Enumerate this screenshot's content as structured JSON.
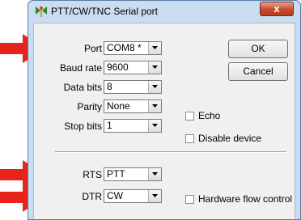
{
  "window": {
    "title": "PTT/CW/TNC Serial port",
    "close_label": "x",
    "icon": "app-antenna-icon"
  },
  "fields": {
    "port": {
      "label": "Port",
      "value": "COM8 *"
    },
    "baud_rate": {
      "label": "Baud rate",
      "value": "9600"
    },
    "data_bits": {
      "label": "Data bits",
      "value": "8"
    },
    "parity": {
      "label": "Parity",
      "value": "None"
    },
    "stop_bits": {
      "label": "Stop bits",
      "value": "1"
    },
    "rts": {
      "label": "RTS",
      "value": "PTT"
    },
    "dtr": {
      "label": "DTR",
      "value": "CW"
    }
  },
  "buttons": {
    "ok": "OK",
    "cancel": "Cancel"
  },
  "checkboxes": {
    "echo": {
      "label": "Echo",
      "checked": false
    },
    "disable_device": {
      "label": "Disable device",
      "checked": false
    },
    "hardware_flow": {
      "label": "Hardware flow control",
      "checked": false
    }
  },
  "annotations": {
    "arrow_color": "#e8231b"
  }
}
